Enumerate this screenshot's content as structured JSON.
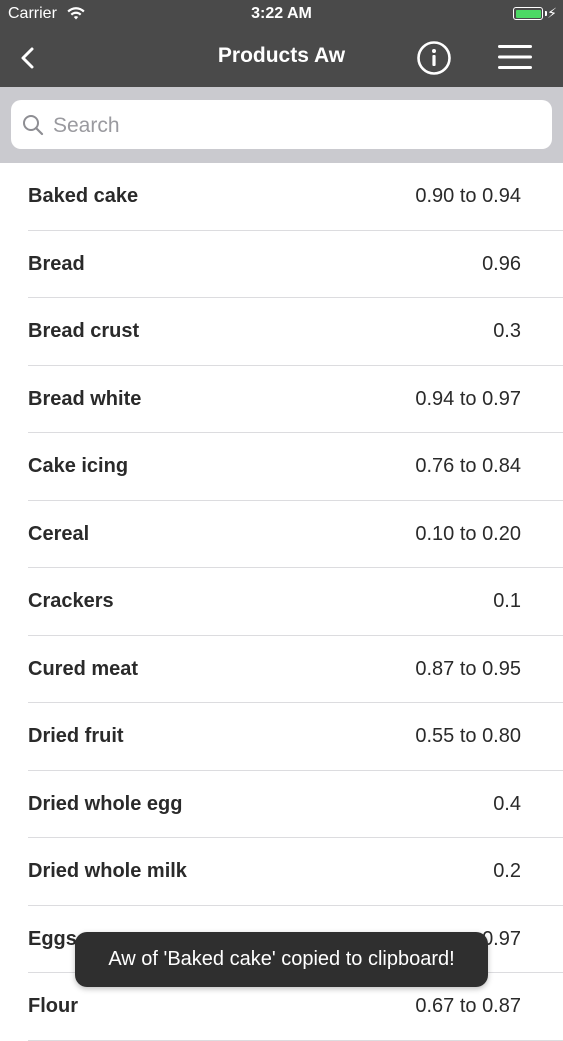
{
  "status_bar": {
    "carrier": "Carrier",
    "time": "3:22 AM",
    "battery_color": "#4cd964"
  },
  "nav": {
    "title": "Products Aw",
    "back_icon": "chevron-left-icon",
    "info_icon": "info-circle-icon",
    "menu_icon": "hamburger-menu-icon",
    "background": "#4a4a4a"
  },
  "search": {
    "placeholder": "Search",
    "value": ""
  },
  "products": [
    {
      "name": "Baked cake",
      "aw": "0.90 to 0.94"
    },
    {
      "name": "Bread",
      "aw": "0.96"
    },
    {
      "name": "Bread crust",
      "aw": "0.3"
    },
    {
      "name": "Bread white",
      "aw": "0.94 to 0.97"
    },
    {
      "name": "Cake icing",
      "aw": "0.76 to 0.84"
    },
    {
      "name": "Cereal",
      "aw": "0.10 to 0.20"
    },
    {
      "name": "Crackers",
      "aw": "0.1"
    },
    {
      "name": "Cured meat",
      "aw": "0.87 to 0.95"
    },
    {
      "name": "Dried fruit",
      "aw": "0.55 to 0.80"
    },
    {
      "name": "Dried whole egg",
      "aw": "0.4"
    },
    {
      "name": "Dried whole milk",
      "aw": "0.2"
    },
    {
      "name": "Eggs",
      "aw": "0.97"
    },
    {
      "name": "Flour",
      "aw": "0.67 to 0.87"
    }
  ],
  "toast": {
    "message": "Aw of 'Baked cake' copied to clipboard!"
  }
}
